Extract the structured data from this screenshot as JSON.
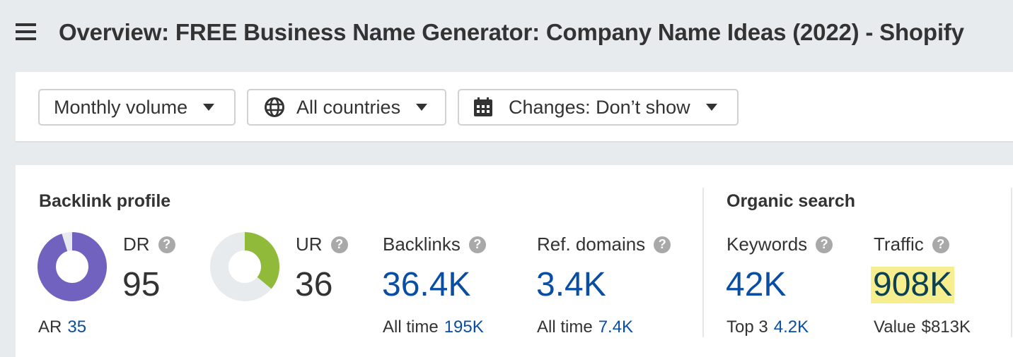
{
  "header": {
    "title": "Overview: FREE Business Name Generator: Company Name Ideas (2022) - Shopify",
    "menu_icon": "hamburger-menu-icon"
  },
  "toolbar": {
    "volume_dropdown": {
      "label": "Monthly volume",
      "icon": "caret-down-icon"
    },
    "country_dropdown": {
      "label": "All countries",
      "icon": "globe-icon"
    },
    "changes_dropdown": {
      "label": "Changes: Don’t show",
      "icon": "calendar-icon"
    }
  },
  "backlink_profile": {
    "title": "Backlink profile",
    "dr": {
      "label": "DR",
      "value": "95",
      "percent": 95,
      "color": "#7262c0",
      "track_color": "#e8ebee"
    },
    "ar": {
      "label": "AR",
      "value": "35"
    },
    "ur": {
      "label": "UR",
      "value": "36",
      "percent": 36,
      "color": "#90ba3a",
      "track_color": "#e8ebee"
    },
    "backlinks": {
      "label": "Backlinks",
      "value": "36.4K",
      "sub_label": "All time",
      "sub_value": "195K"
    },
    "ref_domains": {
      "label": "Ref. domains",
      "value": "3.4K",
      "sub_label": "All time",
      "sub_value": "7.4K"
    }
  },
  "organic_search": {
    "title": "Organic search",
    "keywords": {
      "label": "Keywords",
      "value": "42K",
      "sub_label": "Top 3",
      "sub_value": "4.2K"
    },
    "traffic": {
      "label": "Traffic",
      "value": "908K",
      "sub_label": "Value",
      "sub_value": "$813K",
      "highlight_color": "#f7ef8f"
    }
  },
  "help_icon_glyph": "?"
}
